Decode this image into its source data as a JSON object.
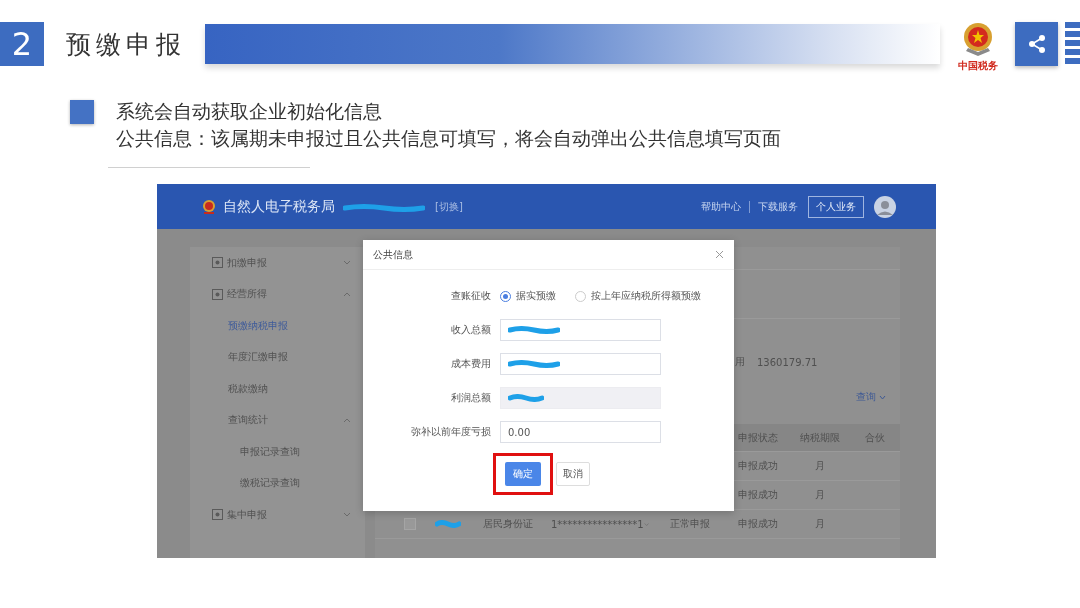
{
  "slide": {
    "number": "2",
    "title": "预缴申报",
    "emblem_caption": "中国税务",
    "bullet_lines": [
      "系统会自动获取企业初始化信息",
      "公共信息：该属期未申报过且公共信息可填写，将会自动弹出公共信息填写页面"
    ]
  },
  "app": {
    "site_title": "自然人电子税务局",
    "switch_link": "[切换]",
    "nav_links": [
      "帮助中心",
      "下载服务"
    ],
    "account_button": "个人业务"
  },
  "sidebar": {
    "items": [
      {
        "label": "扣缴申报",
        "expanded": false,
        "selected": false
      },
      {
        "label": "经营所得",
        "expanded": true,
        "selected": false,
        "children": [
          {
            "label": "预缴纳税申报",
            "selected": true
          },
          {
            "label": "年度汇缴申报",
            "selected": false
          },
          {
            "label": "税款缴纳",
            "selected": false
          },
          {
            "label": "查询统计",
            "expanded": true,
            "selected": false,
            "children": [
              {
                "label": "申报记录查询",
                "selected": false
              },
              {
                "label": "缴税记录查询",
                "selected": false
              }
            ]
          }
        ]
      },
      {
        "label": "集中申报",
        "expanded": false,
        "selected": false
      }
    ]
  },
  "main": {
    "summary_label": "用",
    "summary_value": "1360179.71",
    "query_link": "查询",
    "table": {
      "columns": [
        "申报状态",
        "纳税期限",
        "合伙"
      ],
      "rows": [
        {
          "kind": "partial",
          "status": "申报成功",
          "period": "月"
        },
        {
          "kind": "partial",
          "status": "申报成功",
          "period": "月"
        },
        {
          "kind": "full",
          "checked": false,
          "id_type": "居民身份证",
          "id_number": "1****************1",
          "declare_type": "正常申报",
          "status": "申报成功",
          "period": "月"
        }
      ]
    }
  },
  "dialog": {
    "title": "公共信息",
    "method_label": "查账征收",
    "options": [
      {
        "label": "据实预缴",
        "selected": true
      },
      {
        "label": "按上年应纳税所得额预缴",
        "selected": false
      }
    ],
    "fields": [
      {
        "label": "收入总额",
        "kind": "redacted",
        "disabled": false
      },
      {
        "label": "成本费用",
        "kind": "redacted",
        "disabled": false
      },
      {
        "label": "利润总额",
        "kind": "redacted",
        "disabled": true
      },
      {
        "label": "弥补以前年度亏损",
        "kind": "value",
        "value": "0.00",
        "disabled": false
      }
    ],
    "confirm_button": "确定",
    "cancel_button": "取消",
    "confirm_highlighted": true
  }
}
